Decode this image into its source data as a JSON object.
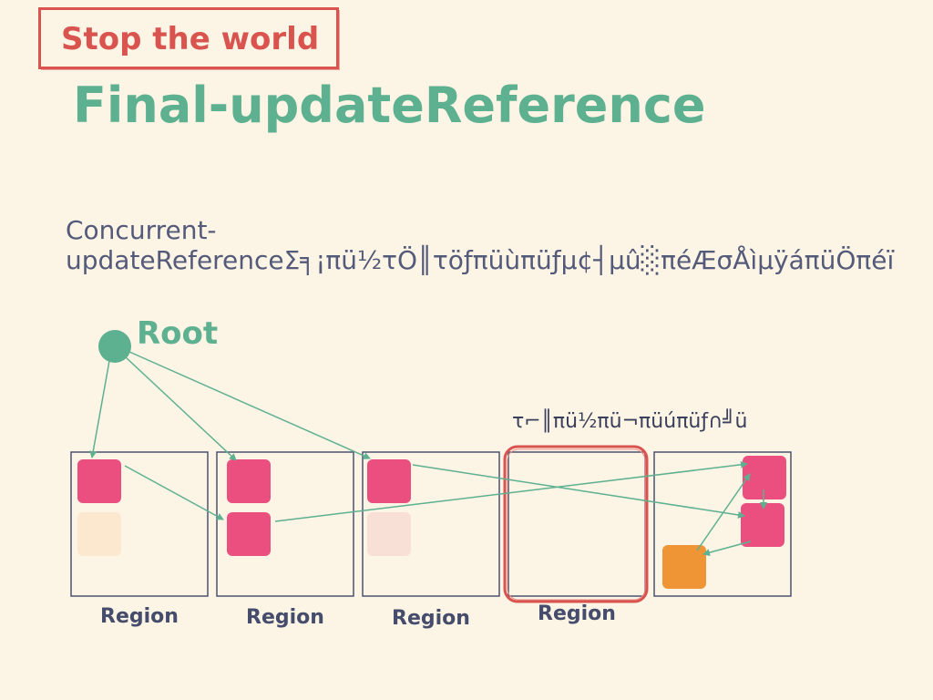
{
  "stamp": {
    "label": "Stop the world"
  },
  "title": "Final-updateReference",
  "subtitle": "Concurrent-updateReferenceΣ╕¡πü½τÖ║τöƒπüùπüƒµ¢┤µû░πéÆσÅìµÿáπüÖπéï",
  "root": {
    "label": "Root"
  },
  "annotation": {
    "empty_region": "τ⌐║πü½πü¬πüúπüƒ∩╝ü"
  },
  "regions": [
    {
      "label": "Region"
    },
    {
      "label": "Region"
    },
    {
      "label": "Region"
    },
    {
      "label": "Region",
      "highlighted": true
    },
    {
      "label": ""
    }
  ],
  "colors": {
    "background": "#fcf4e4",
    "accent_green": "#5db090",
    "stamp_red": "#d9544f",
    "object_pink": "#ea4f80",
    "object_orange": "#f09535",
    "object_faded_1": "#fbe8cf",
    "object_faded_2": "#f9e0d6",
    "region_border": "#4d5170"
  }
}
